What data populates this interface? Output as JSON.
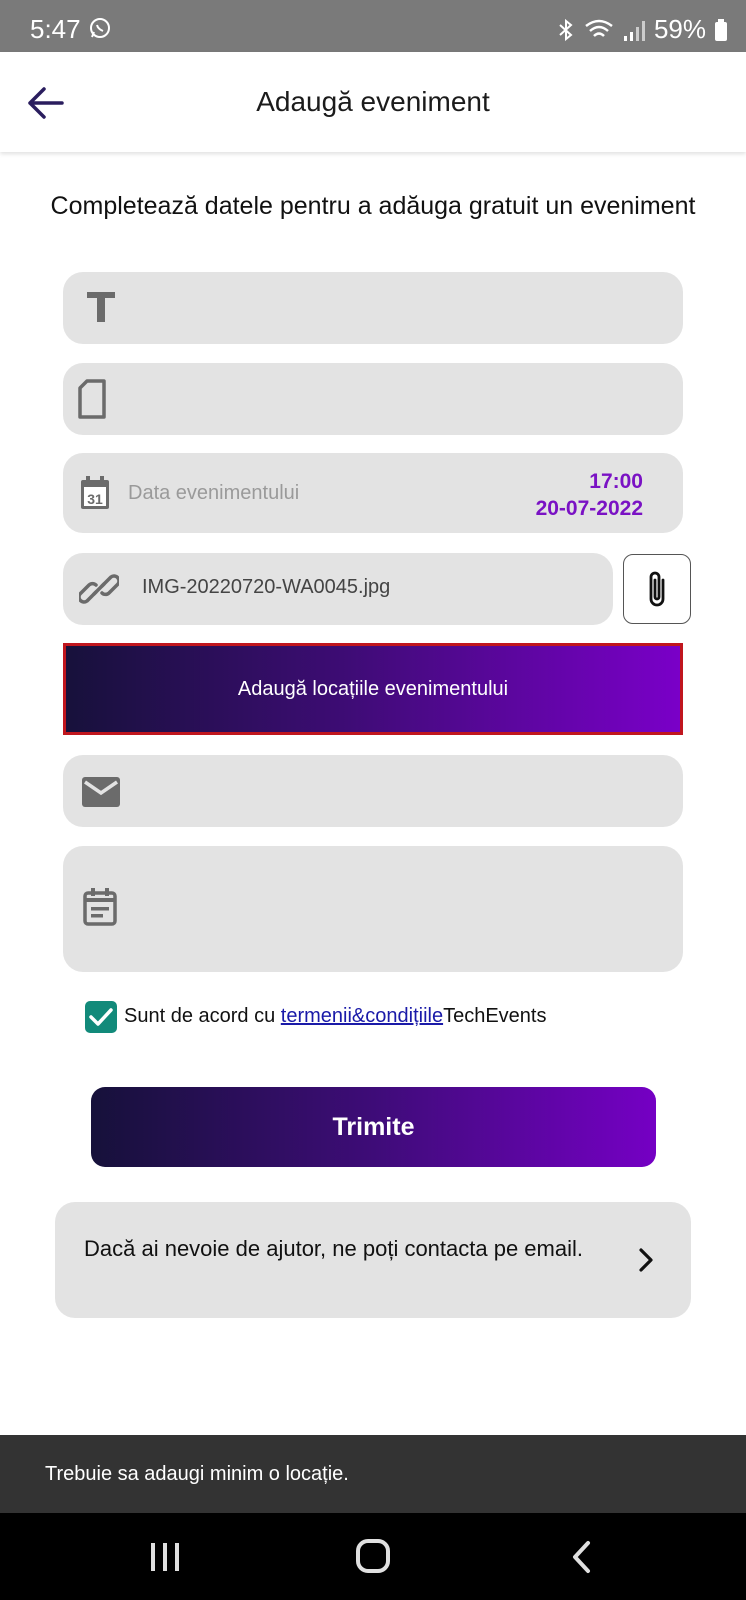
{
  "status_bar": {
    "time": "5:47",
    "battery": "59%",
    "icons": [
      "whatsapp-icon",
      "bluetooth-icon",
      "wifi-icon",
      "signal-icon",
      "battery-icon"
    ]
  },
  "header": {
    "title": "Adaugă eveniment",
    "back_icon": "arrow-left-icon"
  },
  "subtitle": "Completează datele pentru a adăuga gratuit un eveniment",
  "form": {
    "title_field": {
      "icon": "text-format-icon",
      "value": ""
    },
    "description_field": {
      "icon": "document-icon",
      "value": ""
    },
    "date_field": {
      "icon": "calendar-31-icon",
      "placeholder": "Data evenimentului",
      "time": "17:00",
      "date": "20-07-2022"
    },
    "attachment": {
      "icon": "link-icon",
      "file_name": "IMG-20220720-WA0045.jpg",
      "attach_button_icon": "paperclip-icon"
    },
    "locations_button_label": "Adaugă locațiile evenimentului",
    "email_field": {
      "icon": "mail-icon",
      "value": ""
    },
    "details_field": {
      "icon": "event-note-icon",
      "value": ""
    },
    "terms": {
      "checked": true,
      "prefix": "Sunt de acord cu ",
      "link": "termenii&condițiile",
      "suffix": "TechEvents"
    },
    "submit_label": "Trimite"
  },
  "help": {
    "text": "Dacă ai nevoie de ajutor, ne poți contacta pe email.",
    "icon": "chevron-right-icon"
  },
  "snackbar": {
    "message": "Trebuie sa adaugi minim o locație."
  },
  "colors": {
    "accent_purple": "#7a12c4",
    "gradient_start": "#17113b",
    "gradient_end": "#7a00c8",
    "checkbox_green": "#128a7a",
    "error_border": "#c0161e",
    "field_bg": "#e3e3e3"
  }
}
